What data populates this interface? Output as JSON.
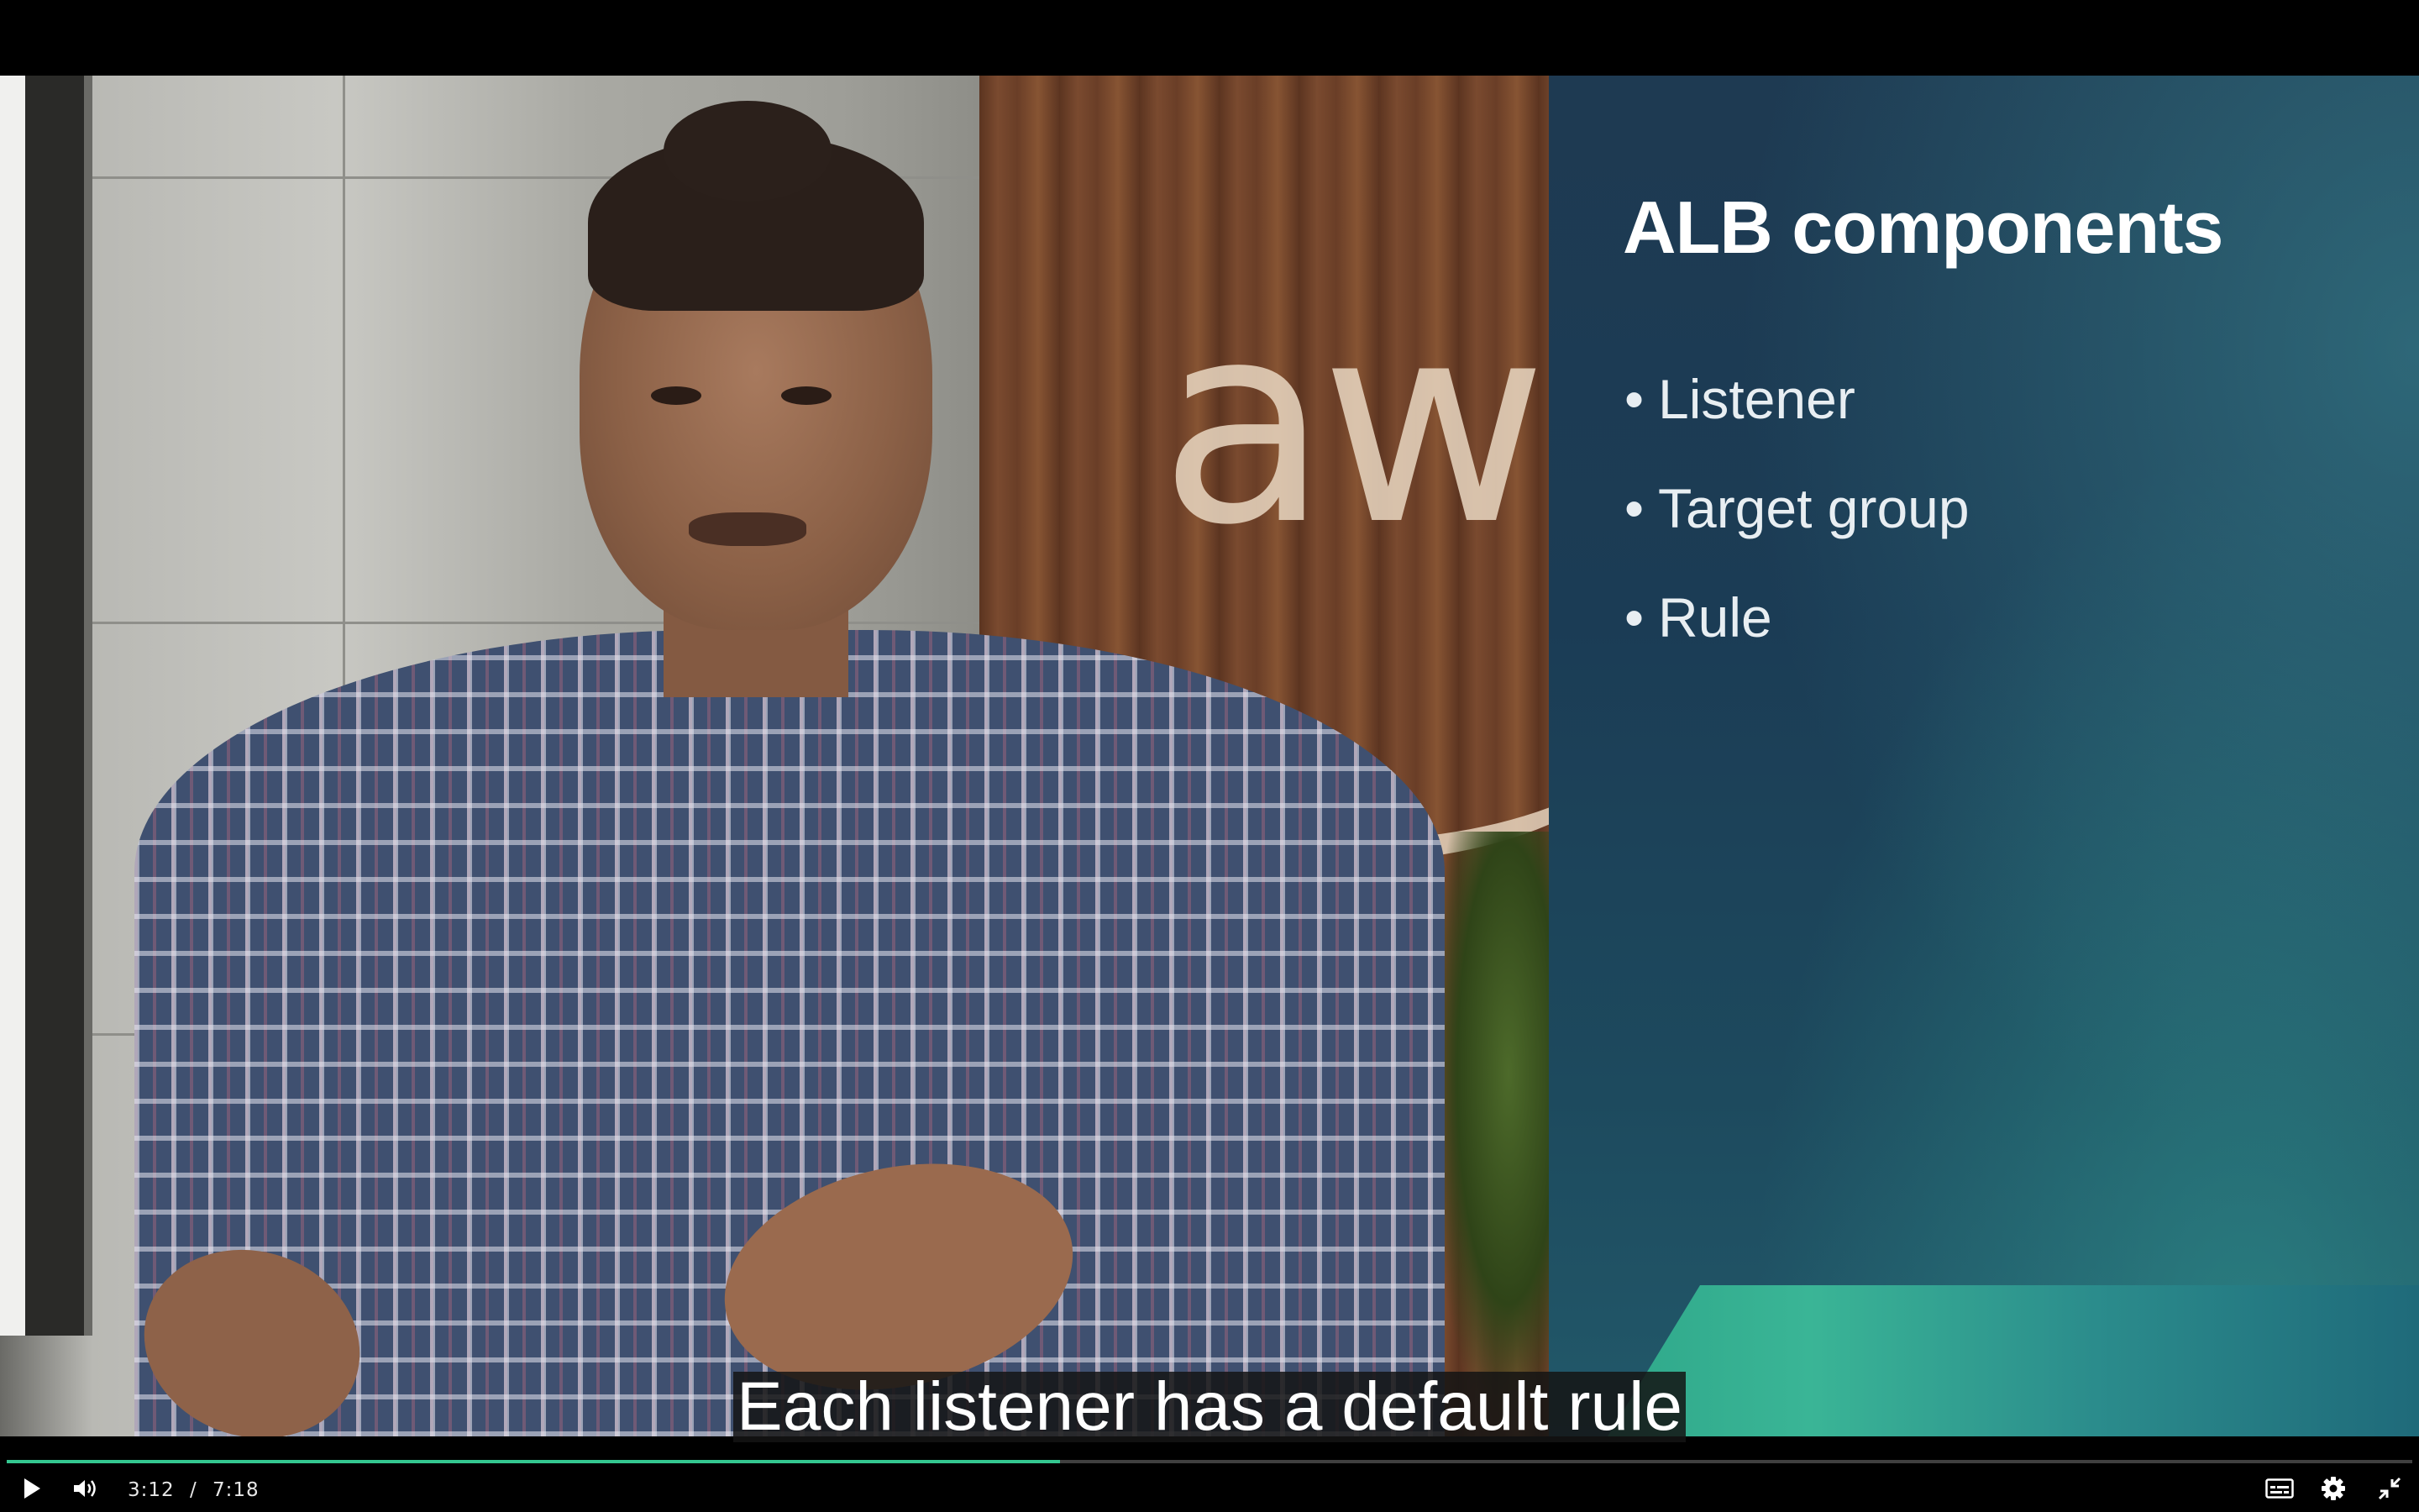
{
  "slide": {
    "title": "ALB components",
    "bullets": [
      "Listener",
      "Target group",
      "Rule"
    ]
  },
  "background": {
    "logo_text": "aw"
  },
  "caption": "Each listener has a default rule",
  "player": {
    "current_time": "3:12",
    "separator": "/",
    "duration": "7:18",
    "progress_fraction": 0.438,
    "accent_color": "#34c790",
    "icons": {
      "play": "play-icon",
      "volume": "volume-icon",
      "captions": "captions-icon",
      "settings": "gear-icon",
      "exit_fullscreen": "exit-fullscreen-icon"
    }
  }
}
